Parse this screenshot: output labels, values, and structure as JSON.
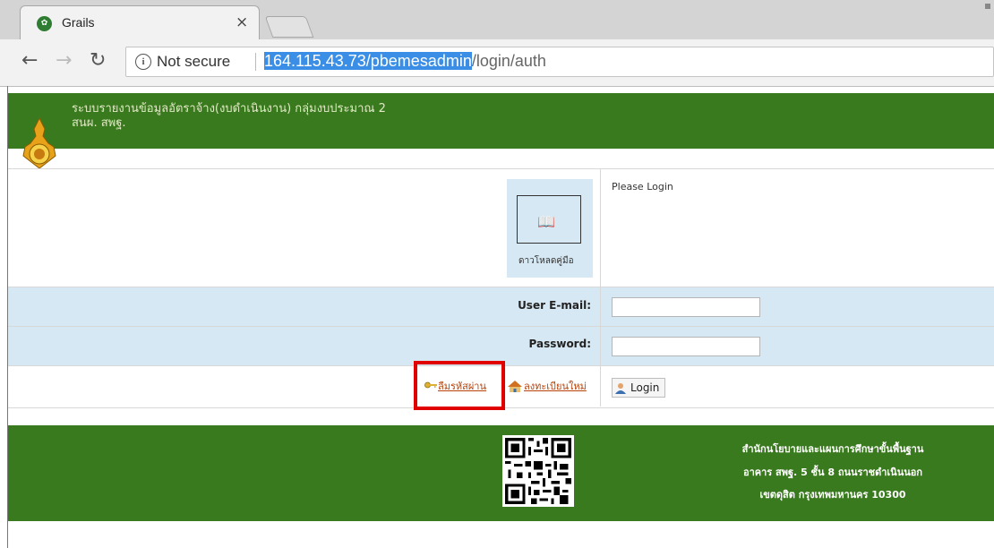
{
  "browser": {
    "tab_title": "Grails",
    "tab_close": "×",
    "url_highlighted": "164.115.43.73/pbemesadmin",
    "url_rest": "/login/auth",
    "security_label": "Not secure",
    "info_icon": "i"
  },
  "header": {
    "title_line1": "ระบบรายงานข้อมูลอัตราจ้าง(งบดำเนินงาน) กลุ่มงบประมาณ 2",
    "title_line2": "สนผ. สพฐ."
  },
  "login": {
    "manual_label": "ดาวโหลดคู่มือ",
    "please_login": "Please Login",
    "email_label": "User E-mail:",
    "email_value": "",
    "password_label": "Password:",
    "password_value": "",
    "forgot_password_link": "ลืมรหัสผ่าน",
    "register_link": "ลงทะเบียนใหม่",
    "login_button": "Login"
  },
  "footer": {
    "line1": "สำนักนโยบายและแผนการศึกษาขั้นพื้นฐาน",
    "line2": "อาคาร สพฐ. 5 ชั้น 8 ถนนราชดำเนินนอก",
    "line3": "เขตดุสิต กรุงเทพมหานคร 10300"
  },
  "colors": {
    "header_green": "#3a7a1e",
    "form_band_blue": "#d6e8f3",
    "link_orange": "#b8420a",
    "highlight_red": "#e10000",
    "url_selection": "#3a8ee6"
  },
  "icons": [
    "grails-favicon-icon",
    "back-arrow-icon",
    "forward-arrow-icon",
    "reload-icon",
    "info-icon",
    "emblem-logo-icon",
    "book-icon",
    "key-icon",
    "home-icon",
    "user-icon",
    "qr-code-icon"
  ]
}
